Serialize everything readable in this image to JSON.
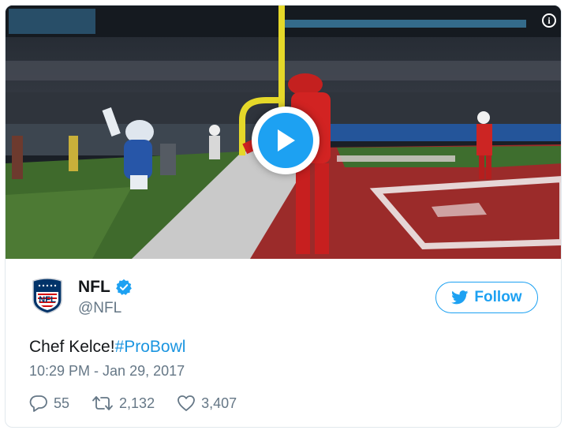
{
  "media": {
    "type": "video",
    "play_icon": "play-icon",
    "info_icon_glyph": "i",
    "accent": "#1da1f2"
  },
  "author": {
    "display_name": "NFL",
    "handle": "@NFL",
    "avatar_icon": "nfl-shield-logo",
    "logo_text": "NFL",
    "verified": true
  },
  "follow_button": {
    "label": "Follow",
    "icon": "twitter-bird-icon"
  },
  "tweet": {
    "text": "Chef Kelce!",
    "hashtag": "#ProBowl",
    "timestamp": "10:29 PM - Jan 29, 2017"
  },
  "actions": {
    "replies": "55",
    "retweets": "2,132",
    "likes": "3,407"
  },
  "colors": {
    "link": "#1b95e0",
    "secondary_text": "#657786",
    "border": "#e1e8ed"
  }
}
